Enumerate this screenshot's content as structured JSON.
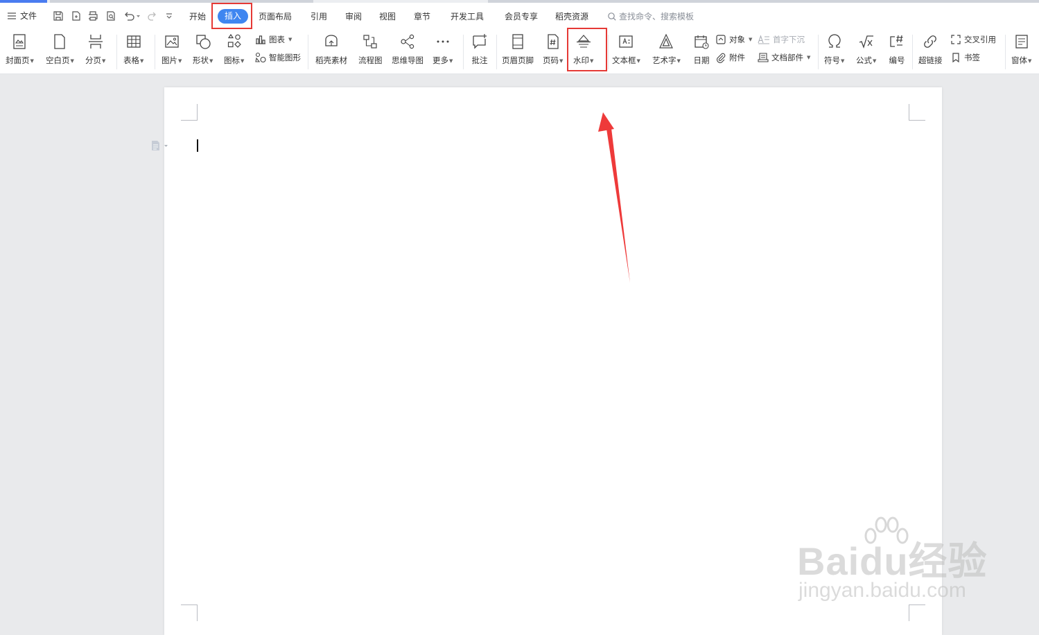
{
  "menu": {
    "file_label": "文件",
    "tabs": [
      "开始",
      "插入",
      "页面布局",
      "引用",
      "审阅",
      "视图",
      "章节",
      "开发工具",
      "会员专享",
      "稻壳资源"
    ],
    "active_tab": "插入",
    "search_placeholder": "查找命令、搜索模板"
  },
  "ribbon": {
    "cover_page": "封面页",
    "blank_page": "空白页",
    "page_break": "分页",
    "table": "表格",
    "picture": "图片",
    "shape": "形状",
    "icon": "图标",
    "chart": "图表",
    "smart_art": "智能图形",
    "docer_material": "稻壳素材",
    "flowchart": "流程图",
    "mind_map": "思维导图",
    "more": "更多",
    "comment": "批注",
    "header_footer": "页眉页脚",
    "page_number": "页码",
    "watermark": "水印",
    "text_box": "文本框",
    "word_art": "艺术字",
    "date": "日期",
    "object": "对象",
    "attachment": "附件",
    "drop_cap": "首字下沉",
    "doc_parts": "文档部件",
    "symbol": "符号",
    "formula": "公式",
    "numbering": "编号",
    "hyperlink": "超链接",
    "cross_reference": "交叉引用",
    "bookmark": "书签",
    "window": "窗体"
  },
  "colors": {
    "accent": "#3f86f0",
    "highlight": "#e53935",
    "arrow": "#ee3a3a"
  },
  "watermark_logo": {
    "brand": "Baidu经验",
    "url": "jingyan.baidu.com"
  }
}
